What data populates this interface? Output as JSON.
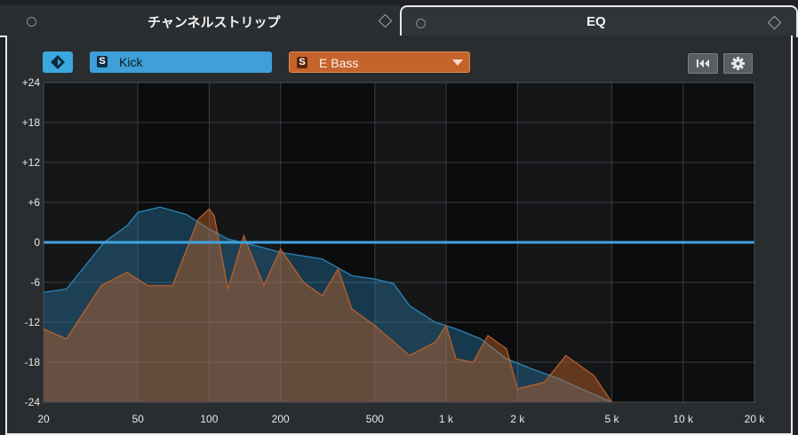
{
  "tabs": [
    {
      "label": "チャンネルストリップ",
      "active": false
    },
    {
      "label": "EQ",
      "active": true
    }
  ],
  "toolbar": {
    "bypass_icon": "diamond-toggle-icon",
    "sources": [
      {
        "badge": "S",
        "label": "Kick",
        "color": "#3f9fd8"
      },
      {
        "badge": "S",
        "label": "E Bass",
        "color": "#c4632b"
      }
    ],
    "rewind_icon": "skip-back-icon",
    "settings_icon": "gear-icon"
  },
  "chart_data": {
    "type": "area",
    "x_scale": "log",
    "x_range": [
      20,
      20000
    ],
    "y_range": [
      -24,
      24
    ],
    "y_ticks": [
      "+24",
      "+18",
      "+12",
      "+6",
      "0",
      "-6",
      "-12",
      "-18",
      "-24"
    ],
    "x_ticks": [
      "20",
      "50",
      "100",
      "200",
      "500",
      "1 k",
      "2 k",
      "5 k",
      "10 k",
      "20 k"
    ],
    "grid": true,
    "eq_curve": {
      "gain_db": 0,
      "color": "#3fa3e0"
    },
    "series": [
      {
        "color": "#2f8fc6",
        "points": [
          [
            20,
            -7.5
          ],
          [
            25,
            -7
          ],
          [
            30,
            -3.5
          ],
          [
            36,
            0
          ],
          [
            45,
            2.5
          ],
          [
            50,
            4.5
          ],
          [
            62,
            5.3
          ],
          [
            80,
            4.2
          ],
          [
            100,
            2
          ],
          [
            120,
            0.5
          ],
          [
            150,
            -0.3
          ],
          [
            200,
            -1.5
          ],
          [
            300,
            -2.5
          ],
          [
            400,
            -5
          ],
          [
            500,
            -5.5
          ],
          [
            600,
            -6.2
          ],
          [
            700,
            -9.5
          ],
          [
            900,
            -12
          ],
          [
            1100,
            -13
          ],
          [
            1400,
            -14.5
          ],
          [
            1800,
            -17.5
          ],
          [
            2300,
            -19
          ],
          [
            3000,
            -20.5
          ],
          [
            4000,
            -22.5
          ],
          [
            5000,
            -24
          ]
        ]
      },
      {
        "color": "#c4632b",
        "points": [
          [
            20,
            -13
          ],
          [
            25,
            -14.5
          ],
          [
            35,
            -6.5
          ],
          [
            45,
            -4.5
          ],
          [
            55,
            -6.5
          ],
          [
            70,
            -6.5
          ],
          [
            90,
            3.5
          ],
          [
            100,
            5
          ],
          [
            105,
            4
          ],
          [
            120,
            -7
          ],
          [
            140,
            1
          ],
          [
            170,
            -6.5
          ],
          [
            200,
            -1
          ],
          [
            250,
            -6
          ],
          [
            300,
            -8
          ],
          [
            350,
            -4
          ],
          [
            400,
            -10
          ],
          [
            500,
            -12.5
          ],
          [
            700,
            -17
          ],
          [
            900,
            -15
          ],
          [
            1000,
            -12.5
          ],
          [
            1100,
            -17.5
          ],
          [
            1300,
            -18
          ],
          [
            1500,
            -14
          ],
          [
            1800,
            -16
          ],
          [
            2000,
            -22
          ],
          [
            2600,
            -21
          ],
          [
            3200,
            -17
          ],
          [
            4200,
            -20
          ],
          [
            5000,
            -24
          ]
        ]
      }
    ]
  }
}
